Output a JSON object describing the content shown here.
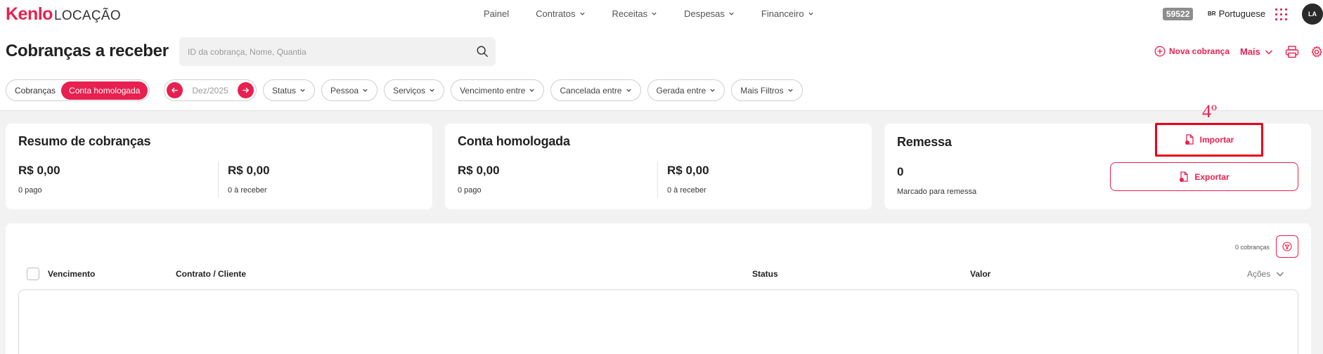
{
  "brand": {
    "name": "Kenlo",
    "product": "LOCAÇÃO",
    "accent": "#e8204f"
  },
  "nav": {
    "items": [
      {
        "label": "Painel",
        "has_dropdown": false
      },
      {
        "label": "Contratos",
        "has_dropdown": true
      },
      {
        "label": "Receitas",
        "has_dropdown": true
      },
      {
        "label": "Despesas",
        "has_dropdown": true
      },
      {
        "label": "Financeiro",
        "has_dropdown": true
      }
    ],
    "badge_number": "59522",
    "language_code": "BR",
    "language": "Portuguese",
    "avatar_initials": "LA"
  },
  "header": {
    "title": "Cobranças a receber",
    "search_placeholder": "ID da cobrança, Nome, Quantia",
    "new_charge_label": "Nova cobrança",
    "more_label": "Mais"
  },
  "filters": {
    "view_toggle": [
      "Cobranças",
      "Conta homologada"
    ],
    "active_view": "Conta homologada",
    "period": "Dez/2025",
    "items": [
      "Status",
      "Pessoa",
      "Serviços",
      "Vencimento entre",
      "Cancelada entre",
      "Gerada entre",
      "Mais Filtros"
    ]
  },
  "summary": {
    "title": "Resumo de cobranças",
    "paid_value": "R$ 0,00",
    "paid_label": "0 pago",
    "receivable_value": "R$ 0,00",
    "receivable_label": "0 à receber"
  },
  "account": {
    "title": "Conta homologada",
    "paid_value": "R$ 0,00",
    "paid_label": "0 pago",
    "receivable_value": "R$ 0,00",
    "receivable_label": "0 à receber"
  },
  "remessa": {
    "title": "Remessa",
    "count": "0",
    "marked_label": "Marcado para remessa",
    "import_label": "Importar",
    "export_label": "Exportar",
    "annotation": "4º"
  },
  "table": {
    "count_label": "0 cobranças",
    "columns": {
      "due": "Vencimento",
      "contract": "Contrato / Cliente",
      "status": "Status",
      "value": "Valor",
      "actions": "Ações"
    }
  }
}
